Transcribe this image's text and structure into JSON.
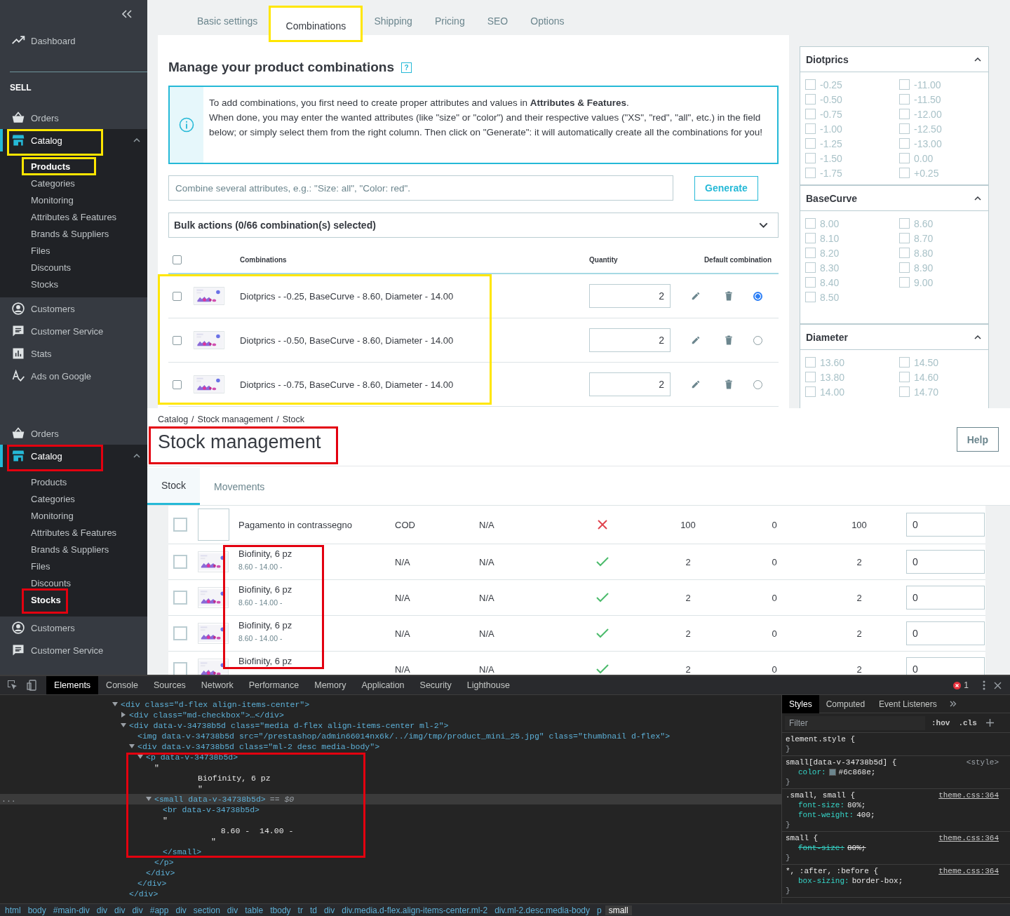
{
  "top_screen": {
    "sidebar": {
      "items": [
        {
          "kind": "chart",
          "label": "Dashboard",
          "selected": false
        },
        {
          "kind": "section",
          "label": "SELL"
        },
        {
          "kind": "basket",
          "label": "Orders",
          "selected": false
        },
        {
          "kind": "store",
          "label": "Catalog",
          "selected": true,
          "expanded": true,
          "color": "#ffe600",
          "children": [
            {
              "label": "Products",
              "selected": true,
              "color": "#ffe600"
            },
            {
              "label": "Categories",
              "selected": false
            },
            {
              "label": "Monitoring",
              "selected": false
            },
            {
              "label": "Attributes & Features",
              "selected": false
            },
            {
              "label": "Brands & Suppliers",
              "selected": false
            },
            {
              "label": "Files",
              "selected": false
            },
            {
              "label": "Discounts",
              "selected": false
            },
            {
              "label": "Stocks",
              "selected": false
            }
          ]
        },
        {
          "kind": "user",
          "label": "Customers",
          "selected": false
        },
        {
          "kind": "chat",
          "label": "Customer Service",
          "selected": false
        },
        {
          "kind": "stats",
          "label": "Stats",
          "selected": false
        },
        {
          "kind": "ads",
          "label": "Ads on Google",
          "selected": false
        }
      ]
    },
    "tabs": [
      {
        "label": "Basic settings",
        "selected": false
      },
      {
        "label": "Combinations",
        "selected": true,
        "color": "#ffe600"
      },
      {
        "label": "Shipping",
        "selected": false
      },
      {
        "label": "Pricing",
        "selected": false
      },
      {
        "label": "SEO",
        "selected": false
      },
      {
        "label": "Options",
        "selected": false
      }
    ],
    "heading": "Manage your product combinations",
    "help_mark": "?",
    "info": [
      "To add combinations, you first need to create proper attributes and values in **Attributes & Features**.",
      "When done, you may enter the wanted attributes (like \"size\" or \"color\") and their respective values (\"XS\", \"red\", \"all\", etc.) in the field below; or simply select them from the right column. Then click on \"Generate\": it will automatically create all the combinations for you!"
    ],
    "combine_field": {
      "placeholder": "Combine several attributes, e.g.: \"Size: all\", \"Color: red\"."
    },
    "generate_button": "Generate",
    "bulk_actions": "Bulk actions (0/66 combination(s) selected)",
    "table": {
      "select_all": false,
      "columns": [
        "Combinations",
        "Quantity",
        "Default combination"
      ],
      "color": "#ffe600",
      "rows": [
        {
          "checked": false,
          "name": "Diotprics - -0.25, BaseCurve - 8.60, Diameter - 14.00",
          "quantity": "2",
          "default": true
        },
        {
          "checked": false,
          "name": "Diotprics - -0.50, BaseCurve - 8.60, Diameter - 14.00",
          "quantity": "2",
          "default": false
        },
        {
          "checked": false,
          "name": "Diotprics - -0.75, BaseCurve - 8.60, Diameter - 14.00",
          "quantity": "2",
          "default": false
        }
      ]
    },
    "filters": [
      {
        "title": "Diotprics",
        "expanded": true,
        "options": [
          {
            "label": "-0.25",
            "checked": false
          },
          {
            "label": "-11.00",
            "checked": false
          },
          {
            "label": "-0.50",
            "checked": false
          },
          {
            "label": "-11.50",
            "checked": false
          },
          {
            "label": "-0.75",
            "checked": false
          },
          {
            "label": "-12.00",
            "checked": false
          },
          {
            "label": "-1.00",
            "checked": false
          },
          {
            "label": "-12.50",
            "checked": false
          },
          {
            "label": "-1.25",
            "checked": false
          },
          {
            "label": "-13.00",
            "checked": false
          },
          {
            "label": "-1.50",
            "checked": false
          },
          {
            "label": "0.00",
            "checked": false
          },
          {
            "label": "-1.75",
            "checked": false
          },
          {
            "label": "+0.25",
            "checked": false
          }
        ]
      },
      {
        "title": "BaseCurve",
        "expanded": true,
        "options": [
          {
            "label": "8.00",
            "checked": false
          },
          {
            "label": "8.60",
            "checked": false
          },
          {
            "label": "8.10",
            "checked": false
          },
          {
            "label": "8.70",
            "checked": false
          },
          {
            "label": "8.20",
            "checked": false
          },
          {
            "label": "8.80",
            "checked": false
          },
          {
            "label": "8.30",
            "checked": false
          },
          {
            "label": "8.90",
            "checked": false
          },
          {
            "label": "8.40",
            "checked": false
          },
          {
            "label": "9.00",
            "checked": false
          },
          {
            "label": "8.50",
            "checked": false
          }
        ]
      },
      {
        "title": "Diameter",
        "expanded": true,
        "options": [
          {
            "label": "13.60",
            "checked": false
          },
          {
            "label": "14.50",
            "checked": false
          },
          {
            "label": "13.80",
            "checked": false
          },
          {
            "label": "14.60",
            "checked": false
          },
          {
            "label": "14.00",
            "checked": false
          },
          {
            "label": "14.70",
            "checked": false
          }
        ]
      }
    ]
  },
  "stock_screen": {
    "sidebar": {
      "items": [
        {
          "kind": "basket",
          "label": "Orders",
          "selected": false
        },
        {
          "kind": "store",
          "label": "Catalog",
          "selected": true,
          "expanded": true,
          "color": "#e3000f",
          "children": [
            {
              "label": "Products",
              "selected": false
            },
            {
              "label": "Categories",
              "selected": false
            },
            {
              "label": "Monitoring",
              "selected": false
            },
            {
              "label": "Attributes & Features",
              "selected": false
            },
            {
              "label": "Brands & Suppliers",
              "selected": false
            },
            {
              "label": "Files",
              "selected": false
            },
            {
              "label": "Discounts",
              "selected": false
            },
            {
              "label": "Stocks",
              "selected": true,
              "color": "#e3000f"
            }
          ]
        },
        {
          "kind": "user",
          "label": "Customers",
          "selected": false
        },
        {
          "kind": "chat",
          "label": "Customer Service",
          "selected": false
        }
      ]
    },
    "breadcrumb": [
      "Catalog",
      "/",
      "Stock management",
      "/",
      "Stock"
    ],
    "title": {
      "text": "Stock management",
      "color": "#e3000f"
    },
    "help_button": "Help",
    "tabs": [
      {
        "label": "Stock",
        "selected": true
      },
      {
        "label": "Movements",
        "selected": false
      }
    ],
    "table": {
      "name_column": {
        "color": "#e3000f"
      },
      "rows": [
        {
          "kind": "service",
          "checked": false,
          "name": "Pagamento in contrassegno",
          "column_3": "COD",
          "column_4": "N/A",
          "active": false,
          "column_6": "100",
          "column_7": "0",
          "column_8": "100",
          "quantity": "0"
        },
        {
          "kind": "product",
          "checked": false,
          "name": "Biofinity, 6 pz",
          "attributes": "8.60 - 14.00 -",
          "column_3": "N/A",
          "column_4": "N/A",
          "active": true,
          "column_6": "2",
          "column_7": "0",
          "column_8": "2",
          "quantity": "0"
        },
        {
          "kind": "product",
          "checked": false,
          "name": "Biofinity, 6 pz",
          "attributes": "8.60 - 14.00 -",
          "column_3": "N/A",
          "column_4": "N/A",
          "active": true,
          "column_6": "2",
          "column_7": "0",
          "column_8": "2",
          "quantity": "0"
        },
        {
          "kind": "product",
          "checked": false,
          "name": "Biofinity, 6 pz",
          "attributes": "8.60 - 14.00 -",
          "column_3": "N/A",
          "column_4": "N/A",
          "active": true,
          "column_6": "2",
          "column_7": "0",
          "column_8": "2",
          "quantity": "0"
        },
        {
          "kind": "product",
          "checked": false,
          "name": "Biofinity, 6 pz",
          "column_3": "N/A",
          "column_4": "N/A",
          "active": true,
          "column_6": "2",
          "column_7": "0",
          "column_8": "2",
          "quantity": "0"
        }
      ]
    }
  },
  "devtools": {
    "tabs": [
      {
        "label": "Elements",
        "selected": true
      },
      {
        "label": "Console",
        "selected": false
      },
      {
        "label": "Sources",
        "selected": false
      },
      {
        "label": "Network",
        "selected": false
      },
      {
        "label": "Performance",
        "selected": false
      },
      {
        "label": "Memory",
        "selected": false
      },
      {
        "label": "Application",
        "selected": false
      },
      {
        "label": "Security",
        "selected": false
      },
      {
        "label": "Lighthouse",
        "selected": false
      }
    ],
    "error_count": "1",
    "dom": [
      {
        "text": "<div class=\"d-flex align-items-center\">",
        "expanded": true,
        "children": [
          {
            "text": "<div class=\"md-checkbox\">…</div>",
            "expanded": false
          },
          {
            "text": "<div data-v-34738b5d class=\"media d-flex align-items-center ml-2\">",
            "expanded": true,
            "children": [
              {
                "text": "<img data-v-34738b5d src=\"/prestashop/admin66014nx6k/../img/tmp/product_mini_25.jpg\" class=\"thumbnail d-flex\">"
              },
              {
                "text": "<div data-v-34738b5d class=\"ml-2 desc media-body\">",
                "expanded": true,
                "children": [
                  {
                    "text": "<p data-v-34738b5d>",
                    "expanded": true,
                    "color": "#e3000f",
                    "children": [
                      {
                        "kind": "text",
                        "text": "\"\n         Biofinity, 6 pz\n         \""
                      },
                      {
                        "text": "<small data-v-34738b5d>",
                        "expanded": true,
                        "selected": true,
                        "gutter": "...",
                        "suffix": "== $0",
                        "children": [
                          {
                            "text": "<br data-v-34738b5d>"
                          },
                          {
                            "kind": "text",
                            "text": "\"\n            8.60 -  14.00 -\n          \""
                          },
                          {
                            "text": "</small>"
                          }
                        ]
                      },
                      {
                        "text": "</p>"
                      }
                    ]
                  },
                  {
                    "text": "</div>"
                  }
                ]
              },
              {
                "text": "</div>"
              }
            ]
          },
          {
            "text": "</div>"
          }
        ]
      }
    ],
    "breadcrumbs": [
      {
        "label": "html",
        "selected": false
      },
      {
        "label": "body",
        "selected": false
      },
      {
        "label": "#main-div",
        "selected": false
      },
      {
        "label": "div",
        "selected": false
      },
      {
        "label": "div",
        "selected": false
      },
      {
        "label": "div",
        "selected": false
      },
      {
        "label": "#app",
        "selected": false
      },
      {
        "label": "div",
        "selected": false
      },
      {
        "label": "section",
        "selected": false
      },
      {
        "label": "div",
        "selected": false
      },
      {
        "label": "table",
        "selected": false
      },
      {
        "label": "tbody",
        "selected": false
      },
      {
        "label": "tr",
        "selected": false
      },
      {
        "label": "td",
        "selected": false
      },
      {
        "label": "div",
        "selected": false
      },
      {
        "label": "div.media.d-flex.align-items-center.ml-2",
        "selected": false
      },
      {
        "label": "div.ml-2.desc.media-body",
        "selected": false
      },
      {
        "label": "p",
        "selected": false
      },
      {
        "label": "small",
        "selected": true
      }
    ],
    "styles_tabs": [
      {
        "label": "Styles",
        "selected": true
      },
      {
        "label": "Computed",
        "selected": false
      },
      {
        "label": "Event Listeners",
        "selected": false
      }
    ],
    "filter": {
      "placeholder": "Filter"
    },
    "hov": ":hov",
    "cls": ".cls",
    "rules": [
      {
        "selector": "element.style {",
        "close": "}"
      },
      {
        "selector": "small[data-v-34738b5d] {",
        "source": "<style>",
        "close": "}",
        "props": [
          {
            "name": "color:",
            "value": "#6c868e;",
            "color": "#6c868e",
            "struck": false
          }
        ]
      },
      {
        "selector": ".small, small {",
        "source": "theme.css:364",
        "close": "}",
        "props": [
          {
            "name": "font-size:",
            "value": "80%;",
            "struck": false
          },
          {
            "name": "font-weight:",
            "value": "400;",
            "struck": false
          }
        ]
      },
      {
        "selector": "small {",
        "source": "theme.css:364",
        "close": "}",
        "props": [
          {
            "name": "font-size:",
            "value": "80%;",
            "struck": true
          }
        ]
      },
      {
        "selector": "*, :after, :before {",
        "source": "theme.css:364",
        "close": "}",
        "props": [
          {
            "name": "box-sizing:",
            "value": "border-box;",
            "struck": false
          }
        ]
      }
    ]
  }
}
